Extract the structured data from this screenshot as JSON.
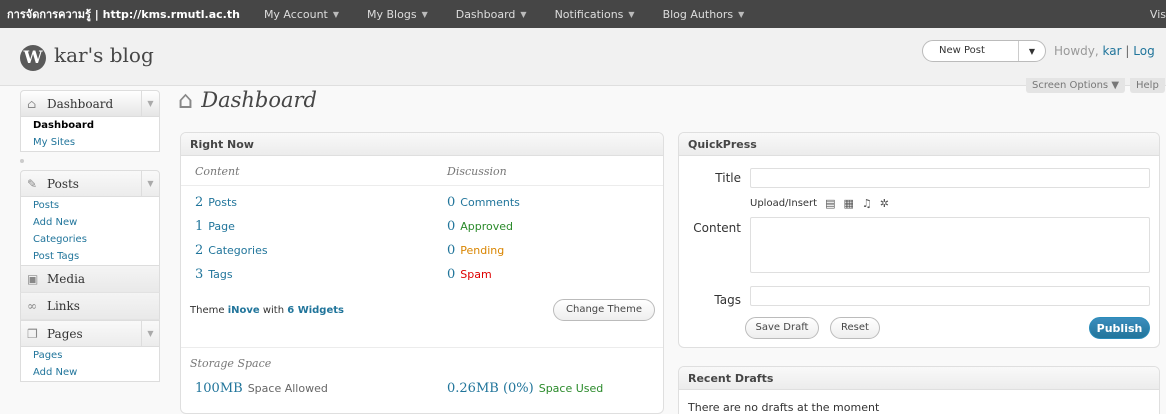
{
  "adminbar": {
    "site": "การจัดการความรู้ | http://kms.rmutl.ac.th",
    "menus": [
      "My Account",
      "My Blogs",
      "Dashboard",
      "Notifications",
      "Blog Authors"
    ],
    "visit": "Vis",
    "caret": "▼"
  },
  "header": {
    "logo": "W",
    "blog_title": "kar's blog",
    "new_post": "New Post",
    "new_post_caret": "▼",
    "howdy": "Howdy,",
    "user": "kar",
    "separator": "|",
    "log": "Log",
    "screen_options": "Screen Options ▼",
    "help": "Help"
  },
  "sidebar": {
    "dashboard_head": "Dashboard",
    "dashboard_items": [
      "Dashboard",
      "My Sites"
    ],
    "posts_head": "Posts",
    "posts_items": [
      "Posts",
      "Add New",
      "Categories",
      "Post Tags"
    ],
    "media": "Media",
    "links": "Links",
    "pages_head": "Pages",
    "pages_items": [
      "Pages",
      "Add New"
    ],
    "arrow": "▼"
  },
  "main": {
    "title": "Dashboard"
  },
  "right_now": {
    "title": "Right Now",
    "content_head": "Content",
    "discussion_head": "Discussion",
    "content": [
      {
        "num": "2",
        "label": "Posts"
      },
      {
        "num": "1",
        "label": "Page"
      },
      {
        "num": "2",
        "label": "Categories"
      },
      {
        "num": "3",
        "label": "Tags"
      }
    ],
    "discussion": [
      {
        "num": "0",
        "label": "Comments"
      },
      {
        "num": "0",
        "label": "Approved"
      },
      {
        "num": "0",
        "label": "Pending"
      },
      {
        "num": "0",
        "label": "Spam"
      }
    ],
    "theme_prefix": "Theme",
    "theme_name": "iNove",
    "theme_with": "with",
    "widgets": "6 Widgets",
    "change_theme": "Change Theme",
    "storage_head": "Storage Space",
    "space_allowed_num": "100MB",
    "space_allowed_label": "Space Allowed",
    "space_used_num": "0.26MB (0%)",
    "space_used_label": "Space Used"
  },
  "quickpress": {
    "title": "QuickPress",
    "title_label": "Title",
    "upload_insert": "Upload/Insert",
    "content_label": "Content",
    "tags_label": "Tags",
    "save_draft": "Save Draft",
    "reset": "Reset",
    "publish": "Publish"
  },
  "recent_drafts": {
    "title": "Recent Drafts",
    "message": "There are no drafts at the moment"
  },
  "colors": {
    "link": "#21759b",
    "adminbar": "#464646",
    "approved": "#2a8a2a",
    "pending": "#d98500",
    "spam": "#dd0000"
  }
}
